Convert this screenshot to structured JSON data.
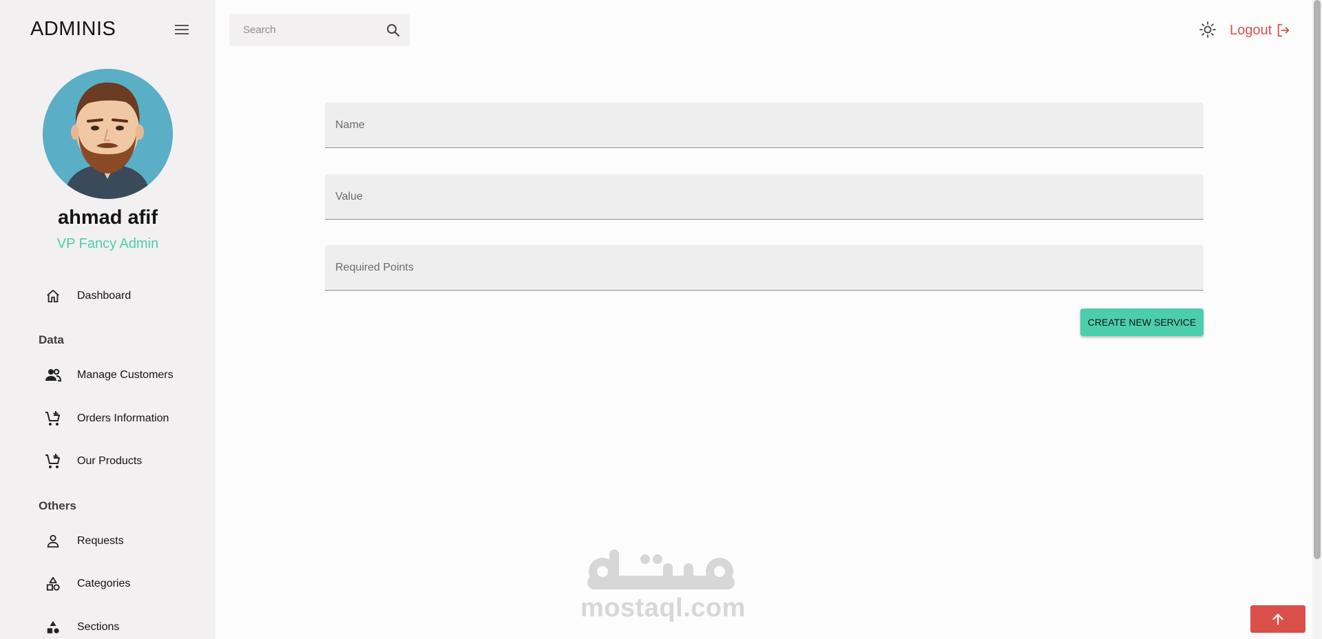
{
  "brand": "ADMINIS",
  "user": {
    "name": "ahmad afif",
    "role": "VP Fancy Admin"
  },
  "nav": {
    "dashboard": "Dashboard",
    "section_data": "Data",
    "manage_customers": "Manage Customers",
    "orders_information": "Orders Information",
    "our_products": "Our Products",
    "section_others": "Others",
    "requests": "Requests",
    "categories": "Categories",
    "sections": "Sections"
  },
  "search": {
    "placeholder": "Search"
  },
  "topbar": {
    "logout_label": "Logout"
  },
  "form": {
    "name_placeholder": "Name",
    "value_placeholder": "Value",
    "required_points_placeholder": "Required Points",
    "submit_label": "CREATE NEW SERVICE"
  },
  "watermark": {
    "url": "mostaql.com"
  },
  "colors": {
    "accent": "#4cceac",
    "danger": "#db4f4a",
    "sidebar": "#f2f0f0"
  },
  "icons": {
    "menu": "hamburger-icon",
    "search": "search-icon",
    "theme": "sun-icon",
    "logout": "logout-icon",
    "dashboard": "home-icon",
    "customers": "people-icon",
    "orders": "cart-add-icon",
    "products": "cart-add-icon",
    "requests": "person-icon",
    "categories": "category-icon",
    "sections": "shapes-icon",
    "scroll_top": "arrow-up-icon"
  }
}
